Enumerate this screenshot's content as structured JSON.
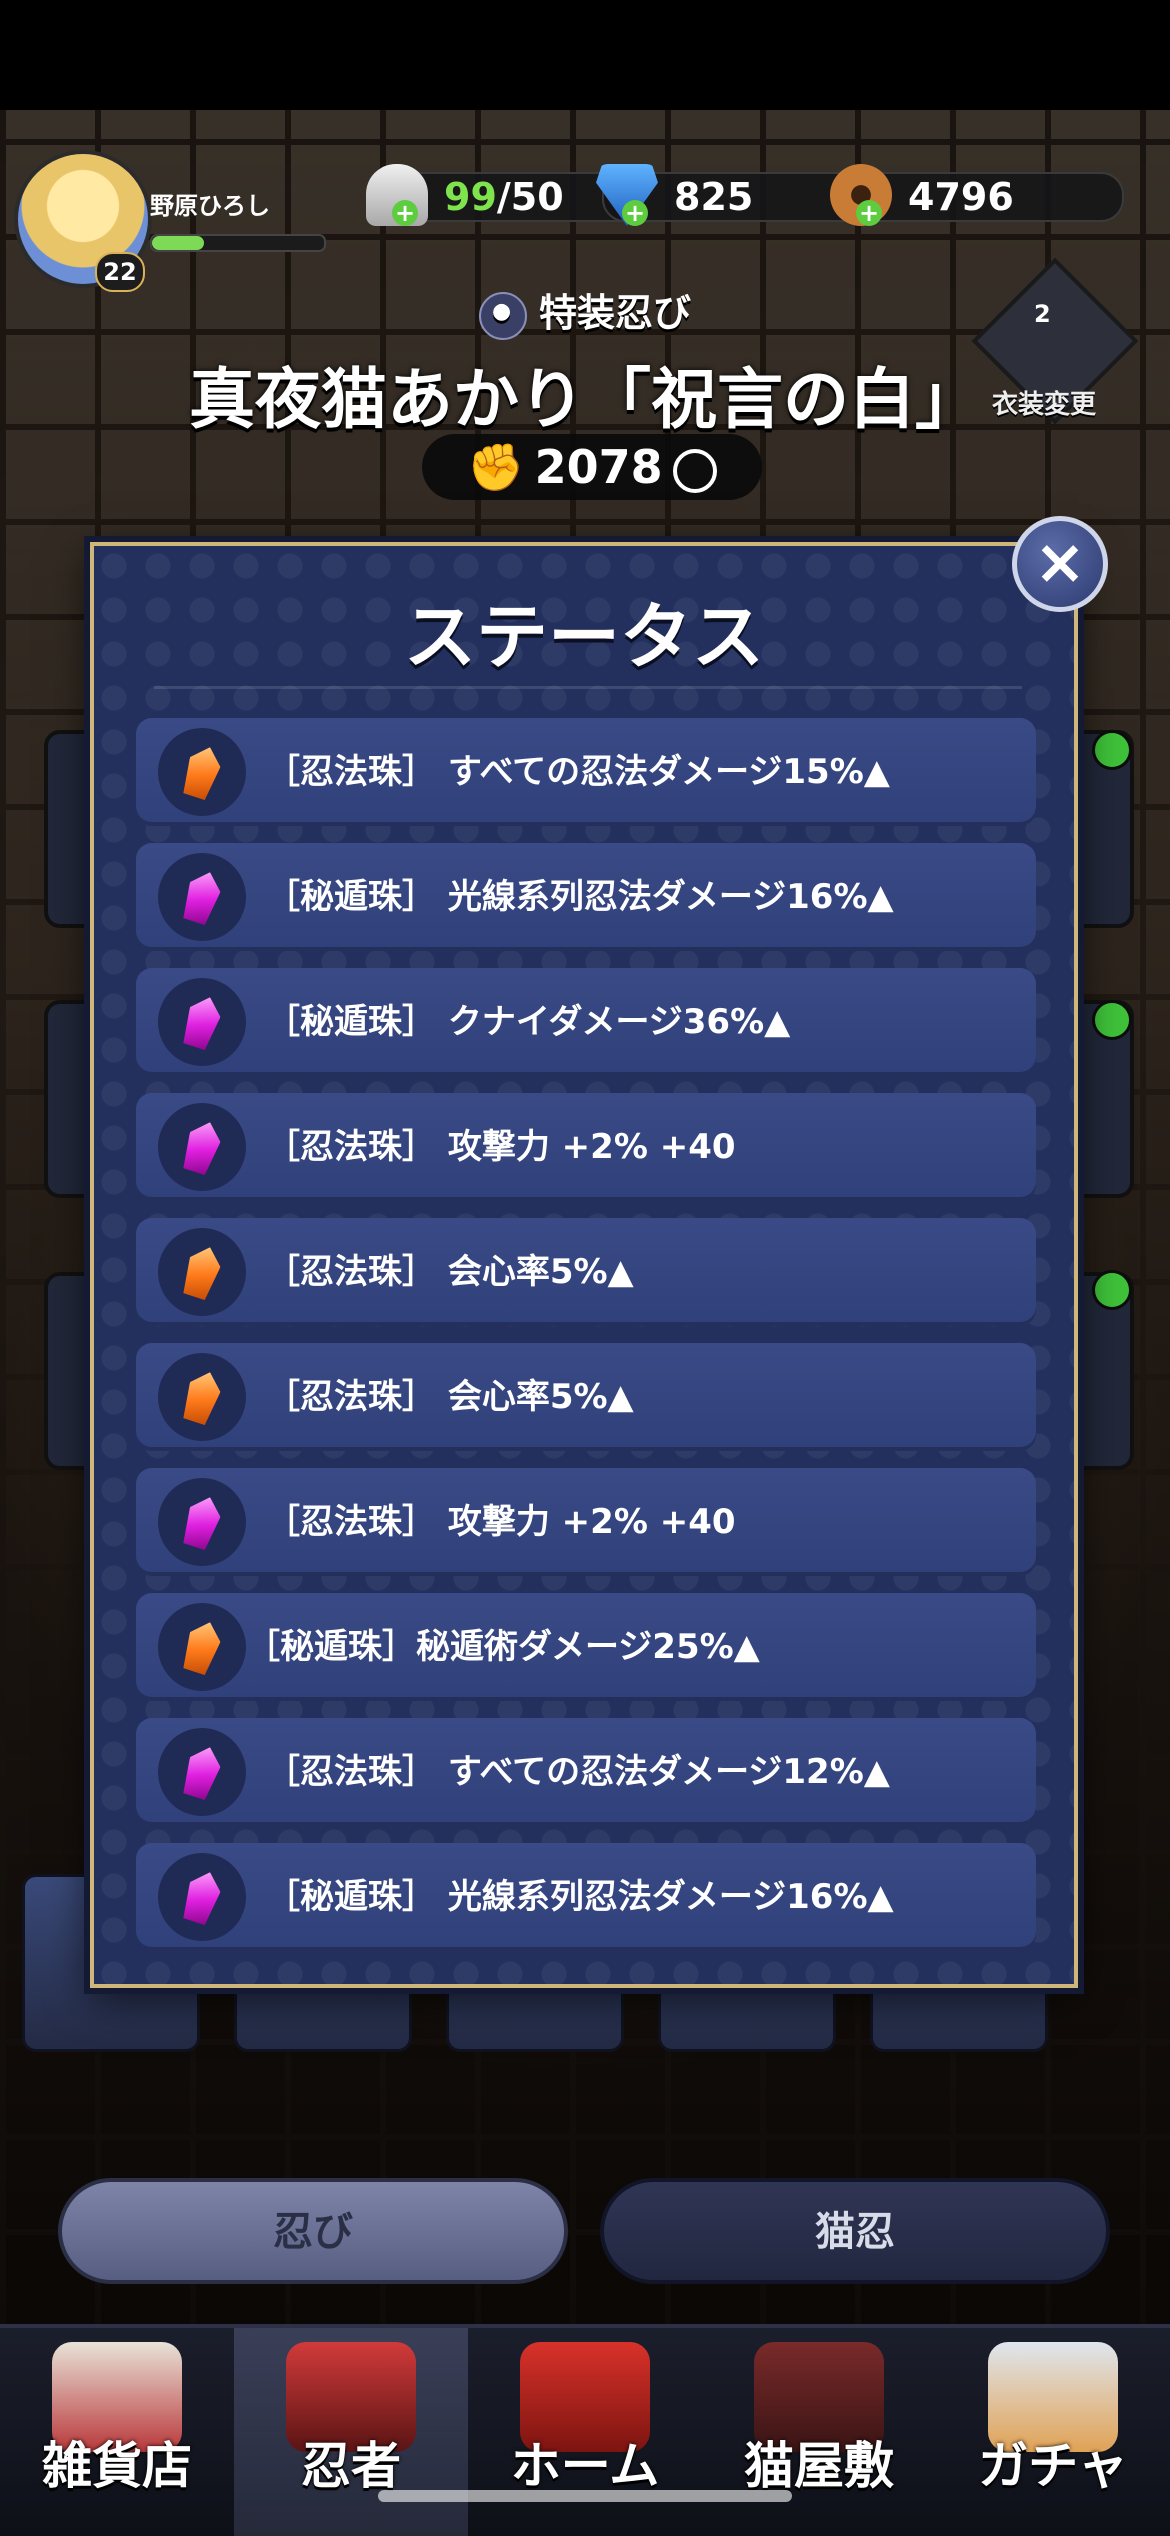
{
  "hud": {
    "player_name": "野原ひろし",
    "player_level": "22",
    "xp_fraction": 0.3,
    "stamina_current": "99",
    "stamina_max": "/50",
    "gems": "825",
    "coins": "4796",
    "plus_label": "+"
  },
  "header": {
    "subtitle": "特装忍び",
    "character_title": "真夜猫あかり「祝言の白」",
    "power": "2078",
    "costume_count": "2",
    "costume_label": "衣装変更"
  },
  "modal": {
    "title": "ステータス",
    "close_label": "×",
    "rows": [
      {
        "gem": "orange",
        "text": "［忍法珠］ すべての忍法ダメージ15%▲"
      },
      {
        "gem": "purple",
        "text": "［秘遁珠］ 光線系列忍法ダメージ16%▲"
      },
      {
        "gem": "purple",
        "text": "［秘遁珠］ クナイダメージ36%▲"
      },
      {
        "gem": "purple",
        "text": "［忍法珠］ 攻撃力 +2% +40"
      },
      {
        "gem": "orange",
        "text": "［忍法珠］ 会心率5%▲"
      },
      {
        "gem": "orange",
        "text": "［忍法珠］ 会心率5%▲"
      },
      {
        "gem": "purple",
        "text": "［忍法珠］ 攻撃力 +2% +40"
      },
      {
        "gem": "orange",
        "text": "［秘遁珠］秘遁術ダメージ25%▲"
      },
      {
        "gem": "purple",
        "text": "［忍法珠］ すべての忍法ダメージ12%▲"
      },
      {
        "gem": "purple",
        "text": "［秘遁珠］ 光線系列忍法ダメージ16%▲"
      }
    ]
  },
  "tabs": {
    "ninja": "忍び",
    "cat_ninja": "猫忍"
  },
  "nav": {
    "shop": "雑貨店",
    "ninja": "忍者",
    "home": "ホーム",
    "cat_house": "猫屋敷",
    "gacha": "ガチャ"
  },
  "colors": {
    "modal_bg": "#23305e",
    "modal_border": "#cfb77a",
    "row_bg": "#34457f",
    "gem_orange": "#ff7a1a",
    "gem_purple": "#e020e0",
    "stamina_green": "#7fe34e"
  }
}
